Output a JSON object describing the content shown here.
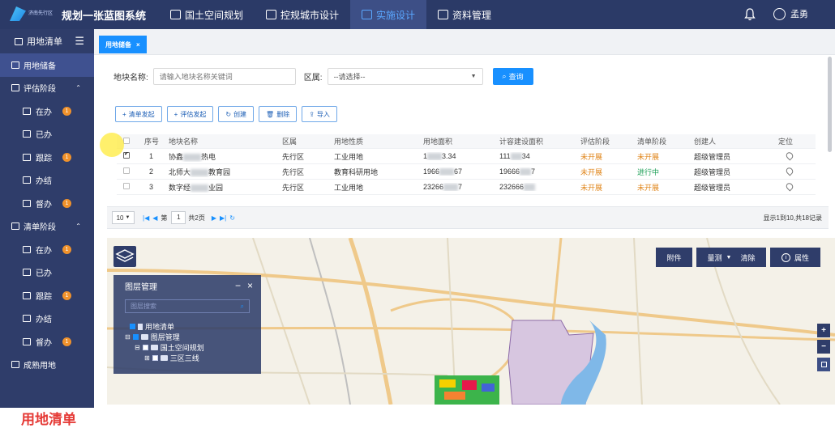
{
  "header": {
    "logo_text": "济南先行区",
    "app_title": "规划一张蓝图系统",
    "nav": [
      {
        "label": "国土空间规划",
        "active": false
      },
      {
        "label": "控规城市设计",
        "active": false
      },
      {
        "label": "实施设计",
        "active": true
      },
      {
        "label": "资料管理",
        "active": false
      }
    ],
    "user_name": "孟勇"
  },
  "sidebar": {
    "title": "用地清单",
    "items": [
      {
        "label": "用地储备",
        "level": 1
      },
      {
        "label": "评估阶段",
        "level": 1
      },
      {
        "label": "在办",
        "level": 2,
        "badge": "1"
      },
      {
        "label": "已办",
        "level": 2
      },
      {
        "label": "跟踪",
        "level": 2,
        "badge": "1"
      },
      {
        "label": "办结",
        "level": 2
      },
      {
        "label": "督办",
        "level": 2,
        "badge": "1"
      },
      {
        "label": "清单阶段",
        "level": 1
      },
      {
        "label": "在办",
        "level": 2,
        "badge": "1"
      },
      {
        "label": "已办",
        "level": 2
      },
      {
        "label": "跟踪",
        "level": 2,
        "badge": "1"
      },
      {
        "label": "办结",
        "level": 2
      },
      {
        "label": "督办",
        "level": 2,
        "badge": "1"
      },
      {
        "label": "成熟用地",
        "level": 1
      }
    ],
    "overlay_caption": "用地清单"
  },
  "tab": {
    "label": "用地储备",
    "close": "×"
  },
  "search": {
    "name_label": "地块名称:",
    "name_placeholder": "请输入地块名称关键词",
    "district_label": "区属:",
    "district_value": "--请选择--",
    "button": "查询"
  },
  "toolbar": [
    "清单发起",
    "评估发起",
    "创建",
    "删除",
    "导入"
  ],
  "table": {
    "columns": [
      "",
      "序号",
      "地块名称",
      "区属",
      "用地性质",
      "用地面积",
      "计容建设面积",
      "评估阶段",
      "清单阶段",
      "创建人",
      "定位"
    ],
    "rows": [
      {
        "checked": true,
        "no": "1",
        "name_a": "协鑫",
        "name_b": "热电",
        "district": "先行区",
        "nature": "工业用地",
        "area_a": "1",
        "area_b": "3.34",
        "build_a": "111",
        "build_b": "34",
        "eval": "未开展",
        "list": "未开展",
        "list_status": "orange",
        "creator": "超级管理员"
      },
      {
        "checked": false,
        "no": "2",
        "name_a": "北师大",
        "name_b": "教育园",
        "district": "先行区",
        "nature": "教育科研用地",
        "area_a": "1966",
        "area_b": "67",
        "build_a": "19666",
        "build_b": "7",
        "eval": "未开展",
        "list": "进行中",
        "list_status": "green",
        "creator": "超级管理员"
      },
      {
        "checked": false,
        "no": "3",
        "name_a": "数字经",
        "name_b": "业园",
        "district": "先行区",
        "nature": "工业用地",
        "area_a": "23266",
        "area_b": "7",
        "build_a": "232666",
        "build_b": "",
        "eval": "未开展",
        "list": "未开展",
        "list_status": "orange",
        "creator": "超级管理员"
      }
    ]
  },
  "pager": {
    "size": "10",
    "page_prefix": "第",
    "page": "1",
    "page_total": "共2页",
    "info": "显示1到10,共18记录"
  },
  "map": {
    "buttons": {
      "attach": "附件",
      "measure": "量测",
      "clear": "清除",
      "attr": "属性"
    },
    "layer_panel": {
      "title": "图层管理",
      "search_placeholder": "图层搜索",
      "tree": [
        "用地清单",
        "图层管理",
        "国土空间规划",
        "三区三线"
      ]
    },
    "zoom_in": "+",
    "zoom_out": "−"
  }
}
